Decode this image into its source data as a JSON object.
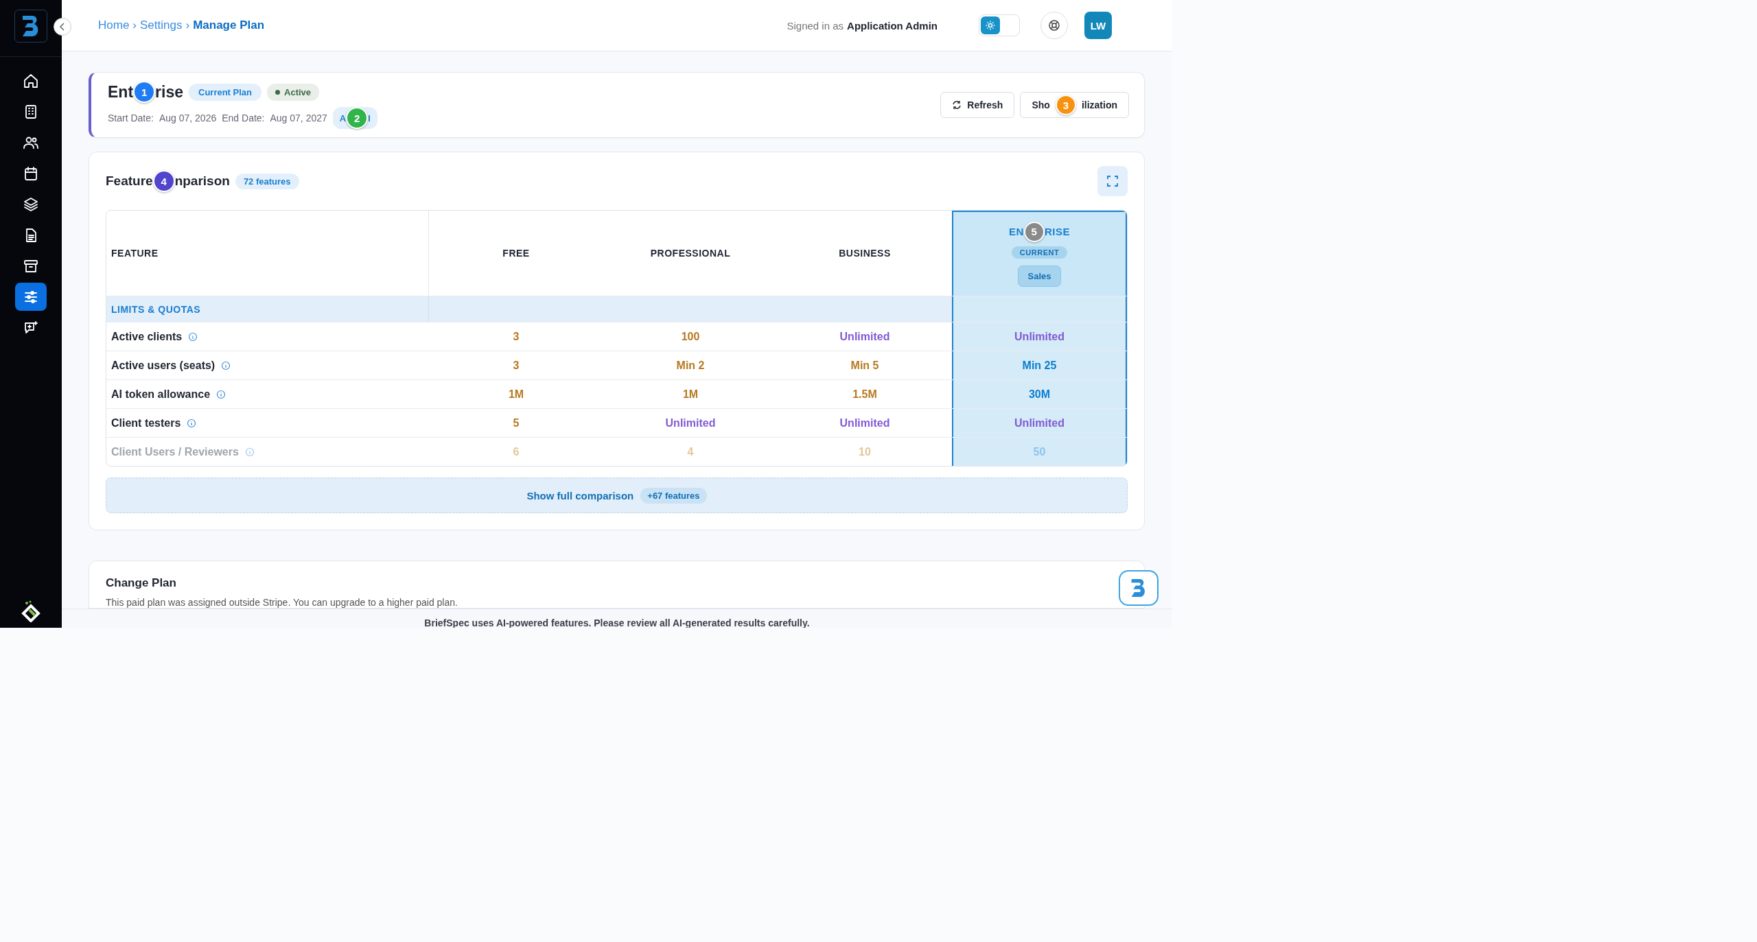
{
  "breadcrumb": [
    {
      "label": "Home",
      "current": false
    },
    {
      "label": "Settings",
      "current": false
    },
    {
      "label": "Manage Plan",
      "current": true
    }
  ],
  "breadcrumb_separator": "›",
  "signed_in": {
    "prefix": "Signed in as",
    "user": "Application Admin"
  },
  "theme_toggle": {
    "on": false
  },
  "avatar": "LW",
  "sidebar": {
    "items": [
      {
        "selected": false
      },
      {
        "selected": false
      },
      {
        "selected": false
      },
      {
        "selected": false
      },
      {
        "selected": false
      },
      {
        "selected": false
      },
      {
        "selected": false
      },
      {
        "selected": true
      },
      {
        "selected": false
      }
    ]
  },
  "plan": {
    "title_before": "Ent",
    "title_after": "rise",
    "title_marker": {
      "number": "1",
      "color": "#1f7cf2"
    },
    "badges": [
      {
        "kind": "tag",
        "label": "Current Plan"
      },
      {
        "kind": "status",
        "label": "Active"
      }
    ],
    "start_label": "Start Date:",
    "start_date": "Aug 07, 2026",
    "end_label": "End Date:",
    "end_date": "Aug 07, 2027",
    "cycle_before": "A",
    "cycle_after": "l",
    "cycle_marker": {
      "number": "2",
      "color": "#2fb54a"
    },
    "refresh": "Refresh",
    "util_before": "Sho",
    "util_after": "ilization",
    "util_marker": {
      "number": "3",
      "color": "#f7920f"
    }
  },
  "comparison": {
    "title_before": "Feature",
    "title_after": "nparison",
    "title_marker": {
      "number": "4",
      "color": "#5145cd"
    },
    "count": "72 features",
    "columns": [
      {
        "label": "FEATURE",
        "current": false
      },
      {
        "label": "FREE",
        "current": false
      },
      {
        "label": "PROFESSIONAL",
        "current": false
      },
      {
        "label": "BUSINESS",
        "current": false
      },
      {
        "label_before": "EN",
        "label_after": "RISE",
        "marker": {
          "number": "5",
          "color": "#8a8a8a"
        },
        "current": true,
        "current_tag": "CURRENT",
        "action": "Sales"
      }
    ],
    "section": "LIMITS & QUOTAS",
    "rows": [
      {
        "feature": "Active clients",
        "faded": false,
        "values": [
          {
            "text": "3",
            "color": "#b7791f"
          },
          {
            "text": "100",
            "color": "#b7791f"
          },
          {
            "text": "Unlimited",
            "color": "#805ad5"
          },
          {
            "text": "Unlimited",
            "color": "#805ad5"
          }
        ]
      },
      {
        "feature": "Active users (seats)",
        "faded": false,
        "values": [
          {
            "text": "3",
            "color": "#b7791f"
          },
          {
            "text": "Min 2",
            "color": "#b7791f"
          },
          {
            "text": "Min 5",
            "color": "#b7791f"
          },
          {
            "text": "Min 25",
            "color": "#0b7dd0"
          }
        ]
      },
      {
        "feature": "AI token allowance",
        "faded": false,
        "values": [
          {
            "text": "1M",
            "color": "#b7791f"
          },
          {
            "text": "1M",
            "color": "#b7791f"
          },
          {
            "text": "1.5M",
            "color": "#b7791f"
          },
          {
            "text": "30M",
            "color": "#0b7dd0"
          }
        ]
      },
      {
        "feature": "Client testers",
        "faded": false,
        "values": [
          {
            "text": "5",
            "color": "#b7791f"
          },
          {
            "text": "Unlimited",
            "color": "#805ad5"
          },
          {
            "text": "Unlimited",
            "color": "#805ad5"
          },
          {
            "text": "Unlimited",
            "color": "#805ad5"
          }
        ]
      },
      {
        "feature": "Client Users / Reviewers",
        "faded": true,
        "values": [
          {
            "text": "6",
            "color": "#e2c898"
          },
          {
            "text": "4",
            "color": "#e2c898"
          },
          {
            "text": "10",
            "color": "#e2c898"
          },
          {
            "text": "50",
            "color": "#8cc4ec"
          }
        ]
      }
    ],
    "show_full": "Show full comparison",
    "more": "+67 features"
  },
  "change_plan": {
    "title": "Change Plan",
    "text": "This paid plan was assigned outside Stripe. You can upgrade to a higher paid plan."
  },
  "footer": "BriefSpec uses AI-powered features. Please review all AI-generated results carefully."
}
